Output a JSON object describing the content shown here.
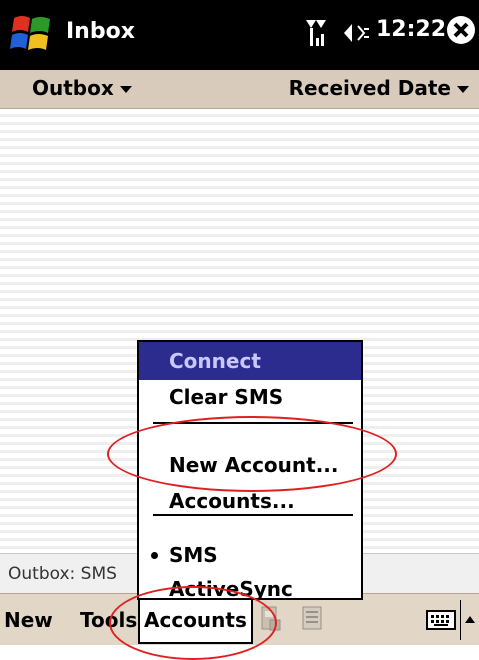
{
  "titlebar": {
    "app_title": "Inbox",
    "clock": "12:22"
  },
  "filterbar": {
    "folder": "Outbox",
    "sort": "Received Date"
  },
  "status": {
    "text": "Outbox: SMS"
  },
  "menubar": {
    "new": "New",
    "tools": "Tools",
    "accounts": "Accounts"
  },
  "popup": {
    "connect": "Connect",
    "clear_sms": "Clear SMS",
    "new_account": "New Account...",
    "accounts": "Accounts...",
    "sms": "SMS",
    "activesync": "ActiveSync"
  },
  "colors": {
    "menu_highlight": "#2c2c8e",
    "bar_beige": "#d8cbbb",
    "annotation_red": "#e02020"
  }
}
